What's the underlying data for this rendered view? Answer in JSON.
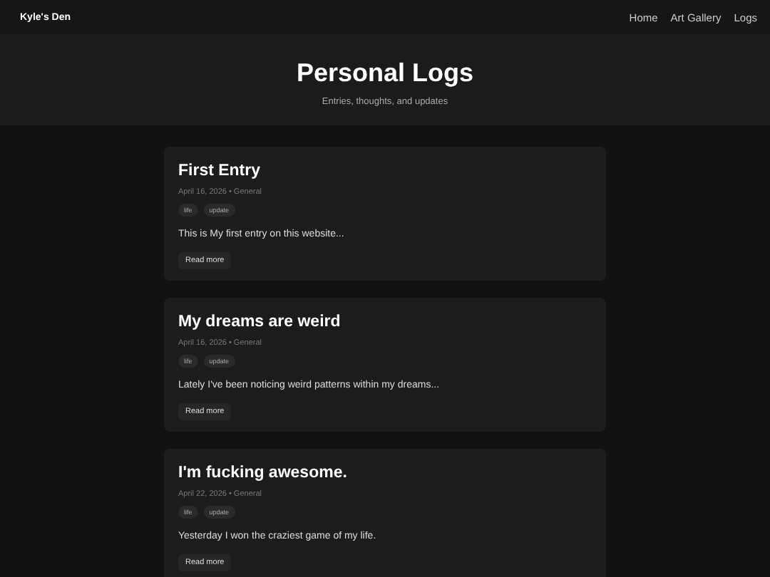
{
  "nav": {
    "brand": "Kyle's Den",
    "links": [
      "Home",
      "Art Gallery",
      "Logs"
    ]
  },
  "hero": {
    "title": "Personal Logs",
    "subtitle": "Entries, thoughts, and updates"
  },
  "posts": [
    {
      "title": "First Entry",
      "meta": "April 16, 2026 • General",
      "tags": [
        "life",
        "update"
      ],
      "excerpt": "This is My first entry on this website...",
      "button": "Read more"
    },
    {
      "title": "My dreams are weird",
      "meta": "April 16, 2026 • General",
      "tags": [
        "life",
        "update"
      ],
      "excerpt": "Lately I've been noticing weird patterns within my dreams...",
      "button": "Read more"
    },
    {
      "title": "I'm fucking awesome.",
      "meta": "April 22, 2026 • General",
      "tags": [
        "life",
        "update"
      ],
      "excerpt": "Yesterday I won the craziest game of my life.",
      "button": "Read more"
    }
  ]
}
